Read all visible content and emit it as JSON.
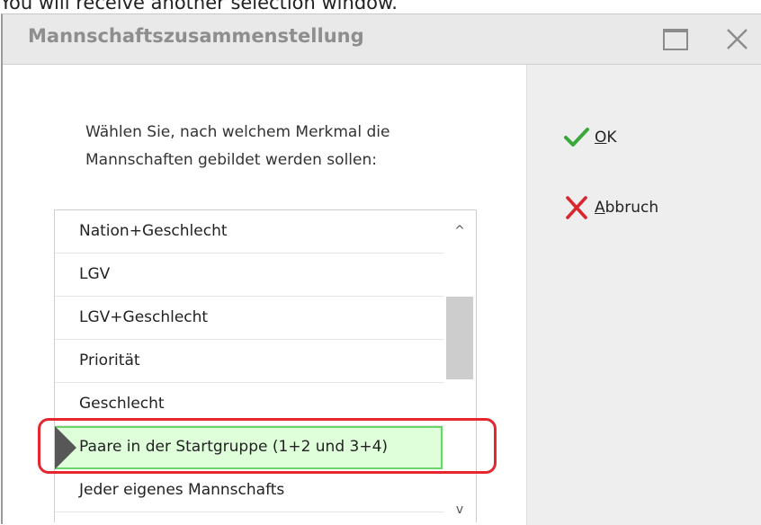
{
  "caption": "You will receive another selection window.",
  "window": {
    "title": "Mannschaftszusammenstellung",
    "maximize_icon": "maximize-icon",
    "close_icon": "close-icon"
  },
  "prompt": {
    "line1": "Wählen Sie, nach welchem Merkmal die",
    "line2": "Mannschaften gebildet werden sollen:"
  },
  "list": {
    "items": [
      {
        "label": "Nation+Geschlecht"
      },
      {
        "label": "LGV"
      },
      {
        "label": "LGV+Geschlecht"
      },
      {
        "label": "Priorität"
      },
      {
        "label": "Geschlecht"
      },
      {
        "label": "Paare in der Startgruppe (1+2 und 3+4)",
        "selected": true
      },
      {
        "label": "Jeder eigenes Mannschafts"
      }
    ],
    "scroll_up_icon": "chevron-up-icon",
    "scroll_down_icon": "chevron-down-icon",
    "scroll_up_glyph": "^",
    "scroll_down_glyph": "v"
  },
  "actions": {
    "ok": {
      "mnemonic": "O",
      "rest": "K",
      "icon": "checkmark-icon",
      "icon_color": "#3aa83a"
    },
    "cancel": {
      "mnemonic": "A",
      "rest": "bbruch",
      "icon": "red-x-icon",
      "icon_color": "#d9262f"
    }
  },
  "colors": {
    "selection_fill": "#dfffdb",
    "selection_border": "#6ad66a",
    "highlight_ring": "#e8262f"
  }
}
